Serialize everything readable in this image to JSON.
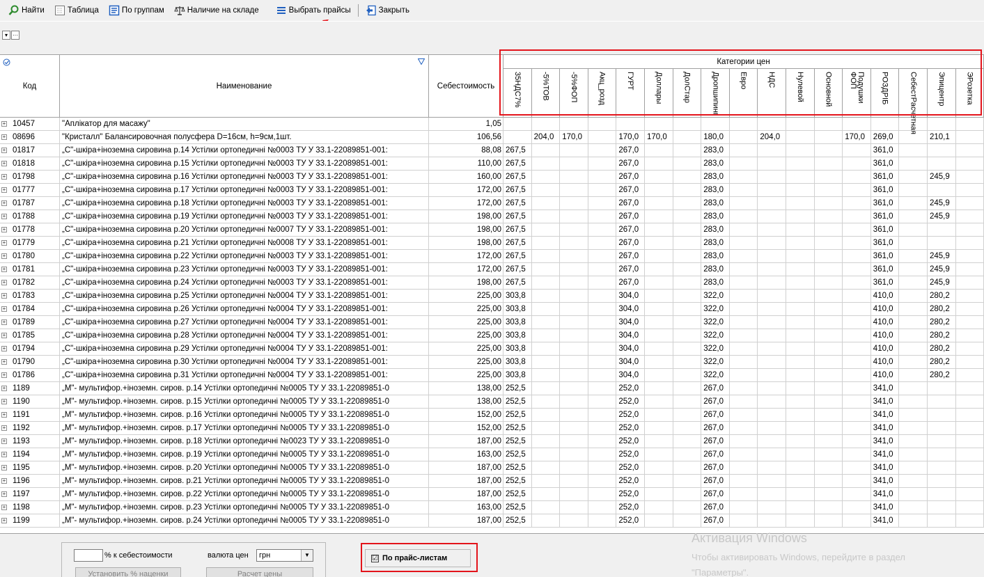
{
  "toolbar": {
    "find": "Найти",
    "table": "Таблица",
    "by_groups": "По группам",
    "in_stock": "Наличие на складе",
    "choose_prices": "Выбрать прайсы",
    "close": "Закрыть"
  },
  "filter_strip": {
    "dropdown": "▾",
    "more": "···"
  },
  "grid": {
    "headers": {
      "code": "Код",
      "name": "Наименование",
      "cost": "Себестоимость",
      "price_categories": "Категории цен"
    },
    "price_columns": [
      "35НДС7%",
      "-5%ТОВ",
      "-5%ФОП",
      "Акц_розд",
      "ГУРТ",
      "Доллары",
      "ДолСтар",
      "Дропшипинг",
      "Евро",
      "НДС",
      "Нулевой",
      "Основной",
      "Подушки ФОП",
      "РОЗДРІБ",
      "СебестРасчетная",
      "Эпицентр",
      "ЭРозетка"
    ],
    "rows": [
      {
        "code": "10457",
        "name": "\"Аплікатор для масажу\"",
        "cost": "1,05",
        "prices": [
          "",
          "",
          "",
          "",
          "",
          "",
          "",
          "",
          "",
          "",
          "",
          "",
          "",
          "",
          "",
          "",
          ""
        ]
      },
      {
        "code": "08696",
        "name": "\"Кристалл\" Балансировочная полусфера D=16см, h=9см,1шт.",
        "cost": "106,56",
        "prices": [
          "",
          "204,0",
          "170,0",
          "",
          "170,0",
          "170,0",
          "",
          "180,0",
          "",
          "204,0",
          "",
          "",
          "170,0",
          "269,0",
          "",
          "210,1",
          ""
        ]
      },
      {
        "code": "01817",
        "name": "„С\"-шкіра+іноземна сировина р.14 Устілки ортопедичні №0003 ТУ У 33.1-22089851-001:",
        "cost": "88,08",
        "prices": [
          "267,5",
          "",
          "",
          "",
          "267,0",
          "",
          "",
          "283,0",
          "",
          "",
          "",
          "",
          "",
          "361,0",
          "",
          "",
          ""
        ]
      },
      {
        "code": "01818",
        "name": "„С\"-шкіра+іноземна сировина р.15 Устілки ортопедичні №0003 ТУ У 33.1-22089851-001:",
        "cost": "110,00",
        "prices": [
          "267,5",
          "",
          "",
          "",
          "267,0",
          "",
          "",
          "283,0",
          "",
          "",
          "",
          "",
          "",
          "361,0",
          "",
          "",
          ""
        ]
      },
      {
        "code": "01798",
        "name": "„С\"-шкіра+іноземна сировина р.16 Устілки ортопедичні №0003 ТУ У 33.1-22089851-001:",
        "cost": "160,00",
        "prices": [
          "267,5",
          "",
          "",
          "",
          "267,0",
          "",
          "",
          "283,0",
          "",
          "",
          "",
          "",
          "",
          "361,0",
          "",
          "245,9",
          ""
        ]
      },
      {
        "code": "01777",
        "name": "„С\"-шкіра+іноземна сировина р.17 Устілки ортопедичні №0003 ТУ У 33.1-22089851-001:",
        "cost": "172,00",
        "prices": [
          "267,5",
          "",
          "",
          "",
          "267,0",
          "",
          "",
          "283,0",
          "",
          "",
          "",
          "",
          "",
          "361,0",
          "",
          "",
          ""
        ]
      },
      {
        "code": "01787",
        "name": "„С\"-шкіра+іноземна сировина р.18 Устілки ортопедичні №0003 ТУ У 33.1-22089851-001:",
        "cost": "172,00",
        "prices": [
          "267,5",
          "",
          "",
          "",
          "267,0",
          "",
          "",
          "283,0",
          "",
          "",
          "",
          "",
          "",
          "361,0",
          "",
          "245,9",
          ""
        ]
      },
      {
        "code": "01788",
        "name": "„С\"-шкіра+іноземна сировина р.19 Устілки ортопедичні №0003 ТУ У 33.1-22089851-001:",
        "cost": "198,00",
        "prices": [
          "267,5",
          "",
          "",
          "",
          "267,0",
          "",
          "",
          "283,0",
          "",
          "",
          "",
          "",
          "",
          "361,0",
          "",
          "245,9",
          ""
        ]
      },
      {
        "code": "01778",
        "name": "„С\"-шкіра+іноземна сировина р.20 Устілки ортопедичні №0007 ТУ У 33.1-22089851-001:",
        "cost": "198,00",
        "prices": [
          "267,5",
          "",
          "",
          "",
          "267,0",
          "",
          "",
          "283,0",
          "",
          "",
          "",
          "",
          "",
          "361,0",
          "",
          "",
          ""
        ]
      },
      {
        "code": "01779",
        "name": "„С\"-шкіра+іноземна сировина р.21 Устілки ортопедичні №0008 ТУ У 33.1-22089851-001:",
        "cost": "198,00",
        "prices": [
          "267,5",
          "",
          "",
          "",
          "267,0",
          "",
          "",
          "283,0",
          "",
          "",
          "",
          "",
          "",
          "361,0",
          "",
          "",
          ""
        ]
      },
      {
        "code": "01780",
        "name": "„С\"-шкіра+іноземна сировина р.22 Устілки ортопедичні №0003 ТУ У 33.1-22089851-001:",
        "cost": "172,00",
        "prices": [
          "267,5",
          "",
          "",
          "",
          "267,0",
          "",
          "",
          "283,0",
          "",
          "",
          "",
          "",
          "",
          "361,0",
          "",
          "245,9",
          ""
        ]
      },
      {
        "code": "01781",
        "name": "„С\"-шкіра+іноземна сировина р.23 Устілки ортопедичні №0003 ТУ У 33.1-22089851-001:",
        "cost": "172,00",
        "prices": [
          "267,5",
          "",
          "",
          "",
          "267,0",
          "",
          "",
          "283,0",
          "",
          "",
          "",
          "",
          "",
          "361,0",
          "",
          "245,9",
          ""
        ]
      },
      {
        "code": "01782",
        "name": "„С\"-шкіра+іноземна сировина р.24 Устілки ортопедичні №0003 ТУ У 33.1-22089851-001:",
        "cost": "198,00",
        "prices": [
          "267,5",
          "",
          "",
          "",
          "267,0",
          "",
          "",
          "283,0",
          "",
          "",
          "",
          "",
          "",
          "361,0",
          "",
          "245,9",
          ""
        ]
      },
      {
        "code": "01783",
        "name": "„С\"-шкіра+іноземна сировина р.25 Устілки ортопедичні №0004 ТУ У 33.1-22089851-001:",
        "cost": "225,00",
        "prices": [
          "303,8",
          "",
          "",
          "",
          "304,0",
          "",
          "",
          "322,0",
          "",
          "",
          "",
          "",
          "",
          "410,0",
          "",
          "280,2",
          ""
        ]
      },
      {
        "code": "01784",
        "name": "„С\"-шкіра+іноземна сировина р.26 Устілки ортопедичні №0004 ТУ У 33.1-22089851-001:",
        "cost": "225,00",
        "prices": [
          "303,8",
          "",
          "",
          "",
          "304,0",
          "",
          "",
          "322,0",
          "",
          "",
          "",
          "",
          "",
          "410,0",
          "",
          "280,2",
          ""
        ]
      },
      {
        "code": "01789",
        "name": "„С\"-шкіра+іноземна сировина р.27 Устілки ортопедичні №0004 ТУ У 33.1-22089851-001:",
        "cost": "225,00",
        "prices": [
          "303,8",
          "",
          "",
          "",
          "304,0",
          "",
          "",
          "322,0",
          "",
          "",
          "",
          "",
          "",
          "410,0",
          "",
          "280,2",
          ""
        ]
      },
      {
        "code": "01785",
        "name": "„С\"-шкіра+іноземна сировина р.28 Устілки ортопедичні №0004 ТУ У 33.1-22089851-001:",
        "cost": "225,00",
        "prices": [
          "303,8",
          "",
          "",
          "",
          "304,0",
          "",
          "",
          "322,0",
          "",
          "",
          "",
          "",
          "",
          "410,0",
          "",
          "280,2",
          ""
        ]
      },
      {
        "code": "01794",
        "name": "„С\"-шкіра+іноземна сировина р.29 Устілки ортопедичні №0004 ТУ У 33.1-22089851-001:",
        "cost": "225,00",
        "prices": [
          "303,8",
          "",
          "",
          "",
          "304,0",
          "",
          "",
          "322,0",
          "",
          "",
          "",
          "",
          "",
          "410,0",
          "",
          "280,2",
          ""
        ]
      },
      {
        "code": "01790",
        "name": "„С\"-шкіра+іноземна сировина р.30 Устілки ортопедичні №0004 ТУ У 33.1-22089851-001:",
        "cost": "225,00",
        "prices": [
          "303,8",
          "",
          "",
          "",
          "304,0",
          "",
          "",
          "322,0",
          "",
          "",
          "",
          "",
          "",
          "410,0",
          "",
          "280,2",
          ""
        ]
      },
      {
        "code": "01786",
        "name": "„С\"-шкіра+іноземна сировина р.31 Устілки ортопедичні №0004 ТУ У 33.1-22089851-001:",
        "cost": "225,00",
        "prices": [
          "303,8",
          "",
          "",
          "",
          "304,0",
          "",
          "",
          "322,0",
          "",
          "",
          "",
          "",
          "",
          "410,0",
          "",
          "280,2",
          ""
        ]
      },
      {
        "code": "1189",
        "name": "„М\"- мультифор.+іноземн. сиров. р.14 Устілки ортопедичні №0005 ТУ У 33.1-22089851-0",
        "cost": "138,00",
        "prices": [
          "252,5",
          "",
          "",
          "",
          "252,0",
          "",
          "",
          "267,0",
          "",
          "",
          "",
          "",
          "",
          "341,0",
          "",
          "",
          ""
        ]
      },
      {
        "code": "1190",
        "name": "„М\"- мультифор.+іноземн. сиров. р.15 Устілки ортопедичні №0005 ТУ У 33.1-22089851-0",
        "cost": "138,00",
        "prices": [
          "252,5",
          "",
          "",
          "",
          "252,0",
          "",
          "",
          "267,0",
          "",
          "",
          "",
          "",
          "",
          "341,0",
          "",
          "",
          ""
        ]
      },
      {
        "code": "1191",
        "name": "„М\"- мультифор.+іноземн. сиров. р.16 Устілки ортопедичні №0005 ТУ У 33.1-22089851-0",
        "cost": "152,00",
        "prices": [
          "252,5",
          "",
          "",
          "",
          "252,0",
          "",
          "",
          "267,0",
          "",
          "",
          "",
          "",
          "",
          "341,0",
          "",
          "",
          ""
        ]
      },
      {
        "code": "1192",
        "name": "„М\"- мультифор.+іноземн. сиров. р.17 Устілки ортопедичні №0005 ТУ У 33.1-22089851-0",
        "cost": "152,00",
        "prices": [
          "252,5",
          "",
          "",
          "",
          "252,0",
          "",
          "",
          "267,0",
          "",
          "",
          "",
          "",
          "",
          "341,0",
          "",
          "",
          ""
        ]
      },
      {
        "code": "1193",
        "name": "„М\"- мультифор.+іноземн. сиров. р.18 Устілки ортопедичні №0023 ТУ У 33.1-22089851-0",
        "cost": "187,00",
        "prices": [
          "252,5",
          "",
          "",
          "",
          "252,0",
          "",
          "",
          "267,0",
          "",
          "",
          "",
          "",
          "",
          "341,0",
          "",
          "",
          ""
        ]
      },
      {
        "code": "1194",
        "name": "„М\"- мультифор.+іноземн. сиров. р.19 Устілки ортопедичні №0005 ТУ У 33.1-22089851-0",
        "cost": "163,00",
        "prices": [
          "252,5",
          "",
          "",
          "",
          "252,0",
          "",
          "",
          "267,0",
          "",
          "",
          "",
          "",
          "",
          "341,0",
          "",
          "",
          ""
        ]
      },
      {
        "code": "1195",
        "name": "„М\"- мультифор.+іноземн. сиров. р.20 Устілки ортопедичні №0005 ТУ У 33.1-22089851-0",
        "cost": "187,00",
        "prices": [
          "252,5",
          "",
          "",
          "",
          "252,0",
          "",
          "",
          "267,0",
          "",
          "",
          "",
          "",
          "",
          "341,0",
          "",
          "",
          ""
        ]
      },
      {
        "code": "1196",
        "name": "„М\"- мультифор.+іноземн. сиров. р.21 Устілки ортопедичні №0005 ТУ У 33.1-22089851-0",
        "cost": "187,00",
        "prices": [
          "252,5",
          "",
          "",
          "",
          "252,0",
          "",
          "",
          "267,0",
          "",
          "",
          "",
          "",
          "",
          "341,0",
          "",
          "",
          ""
        ]
      },
      {
        "code": "1197",
        "name": "„М\"- мультифор.+іноземн. сиров. р.22 Устілки ортопедичні №0005 ТУ У 33.1-22089851-0",
        "cost": "187,00",
        "prices": [
          "252,5",
          "",
          "",
          "",
          "252,0",
          "",
          "",
          "267,0",
          "",
          "",
          "",
          "",
          "",
          "341,0",
          "",
          "",
          ""
        ]
      },
      {
        "code": "1198",
        "name": "„М\"- мультифор.+іноземн. сиров. р.23 Устілки ортопедичні №0005 ТУ У 33.1-22089851-0",
        "cost": "163,00",
        "prices": [
          "252,5",
          "",
          "",
          "",
          "252,0",
          "",
          "",
          "267,0",
          "",
          "",
          "",
          "",
          "",
          "341,0",
          "",
          "",
          ""
        ]
      },
      {
        "code": "1199",
        "name": "„М\"- мультифор.+іноземн. сиров. р.24 Устілки ортопедичні №0005 ТУ У 33.1-22089851-0",
        "cost": "187,00",
        "prices": [
          "252,5",
          "",
          "",
          "",
          "252,0",
          "",
          "",
          "267,0",
          "",
          "",
          "",
          "",
          "",
          "341,0",
          "",
          "",
          ""
        ]
      }
    ]
  },
  "bottom": {
    "pct_value": "",
    "pct_label": "% к себестоимости",
    "set_markup_button": "Установить % наценки",
    "currency_label": "валюта цен",
    "currency_value": "грн",
    "calc_button": "Расчет цены",
    "by_pricelists_label": "По прайс-листам",
    "by_pricelists_checked": "☑"
  },
  "watermark": {
    "title": "Активация Windows",
    "line1": "Чтобы активировать Windows, перейдите в раздел",
    "line2": "\"Параметры\"."
  },
  "colors": {
    "highlight_red": "#e3141b",
    "toolbar_bg": "#f0f0f0",
    "icon_blue": "#1f5fbf"
  }
}
